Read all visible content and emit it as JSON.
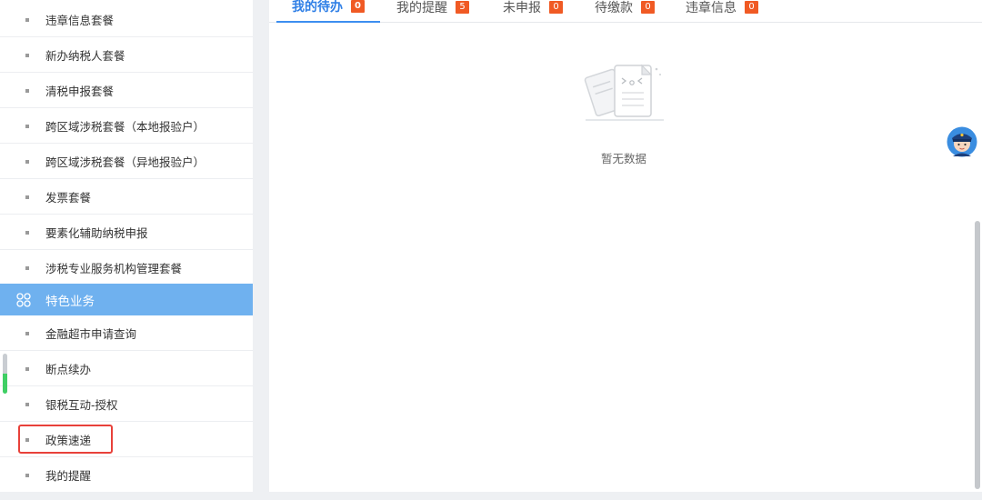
{
  "sidebar": {
    "items_top": [
      {
        "label": "违章信息套餐"
      },
      {
        "label": "新办纳税人套餐"
      },
      {
        "label": "清税申报套餐"
      },
      {
        "label": "跨区域涉税套餐（本地报验户）"
      },
      {
        "label": "跨区域涉税套餐（异地报验户）"
      },
      {
        "label": "发票套餐"
      },
      {
        "label": "要素化辅助纳税申报"
      },
      {
        "label": "涉税专业服务机构管理套餐"
      }
    ],
    "group": {
      "label": "特色业务",
      "icon": "grid-icon"
    },
    "items_bottom": [
      {
        "label": "金融超市申请查询"
      },
      {
        "label": "断点续办"
      },
      {
        "label": "银税互动-授权"
      },
      {
        "label": "政策速递",
        "highlighted": true
      },
      {
        "label": "我的提醒"
      }
    ]
  },
  "tabs": [
    {
      "label": "我的待办",
      "count": "0",
      "active": true
    },
    {
      "label": "我的提醒",
      "count": "5"
    },
    {
      "label": "未申报",
      "count": "0"
    },
    {
      "label": "待缴款",
      "count": "0"
    },
    {
      "label": "违章信息",
      "count": "0"
    }
  ],
  "empty_state": {
    "text": "暂无数据",
    "icon": "empty-document-icon"
  },
  "assistant": {
    "icon": "police-avatar-icon"
  },
  "colors": {
    "accent": "#2f7fe6",
    "group_header": "#6fb1ef",
    "badge": "#f05a24",
    "highlight": "#e8413a"
  }
}
